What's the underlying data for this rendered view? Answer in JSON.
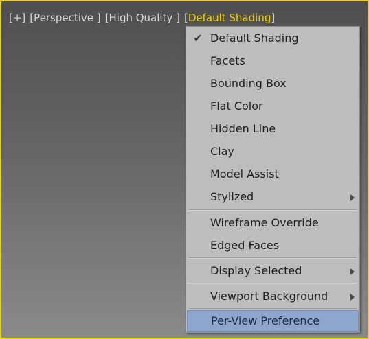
{
  "viewport": {
    "labels": [
      {
        "text": "[+]"
      },
      {
        "text": "[Perspective ]"
      },
      {
        "text": "[High Quality ]"
      },
      {
        "open_bracket": "[",
        "text": "Default Shading",
        "close_bracket": "]"
      }
    ],
    "colors": {
      "border": "#e7d21a",
      "active_label": "#f2d000",
      "label": "#d6d6d6"
    }
  },
  "menu": {
    "items": [
      {
        "label": "Default Shading",
        "checked": true
      },
      {
        "label": "Facets"
      },
      {
        "label": "Bounding Box"
      },
      {
        "label": "Flat Color"
      },
      {
        "label": "Hidden Line"
      },
      {
        "label": "Clay"
      },
      {
        "label": "Model Assist"
      },
      {
        "label": "Stylized",
        "submenu": true
      },
      {
        "label": "Wireframe Override"
      },
      {
        "label": "Edged Faces"
      },
      {
        "label": "Display Selected",
        "submenu": true
      },
      {
        "label": "Viewport Background",
        "submenu": true
      },
      {
        "label": "Per-View Preference",
        "highlighted": true
      }
    ],
    "colors": {
      "background": "#bdbdbd",
      "highlight": "#8fa6cc"
    }
  }
}
